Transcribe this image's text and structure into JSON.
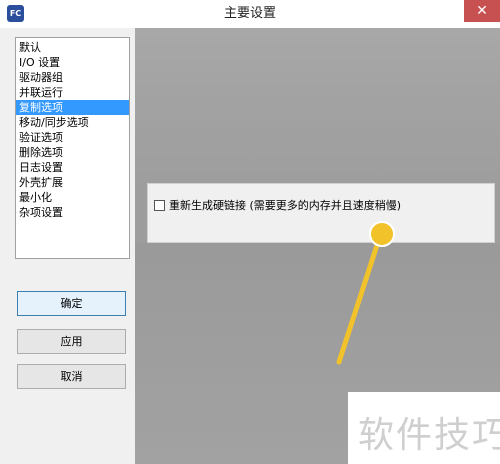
{
  "window": {
    "title": "主要设置",
    "app_icon_text": "FC"
  },
  "sidebar": {
    "items": [
      {
        "label": "默认"
      },
      {
        "label": "I/O 设置"
      },
      {
        "label": "驱动器组"
      },
      {
        "label": "并联运行"
      },
      {
        "label": "复制选项",
        "selected": true
      },
      {
        "label": "移动/同步选项"
      },
      {
        "label": "验证选项"
      },
      {
        "label": "删除选项"
      },
      {
        "label": "日志设置"
      },
      {
        "label": "外壳扩展"
      },
      {
        "label": "最小化"
      },
      {
        "label": "杂项设置"
      }
    ]
  },
  "buttons": {
    "ok": "确定",
    "apply": "应用",
    "cancel": "取消"
  },
  "options": {
    "hardlink_label": "重新生成硬链接 (需要更多的内存并且速度稍慢)",
    "hardlink_checked": false
  },
  "watermark": {
    "text": "软件技巧"
  },
  "colors": {
    "selection": "#3399ff",
    "close_button": "#c75050",
    "annotation": "#f2c22a"
  }
}
